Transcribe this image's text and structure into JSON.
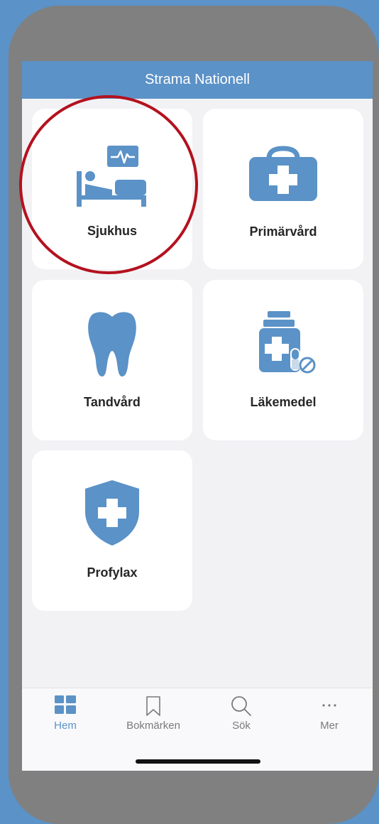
{
  "header": {
    "title": "Strama Nationell"
  },
  "tiles": [
    {
      "label": "Sjukhus",
      "icon": "hospital-bed-icon"
    },
    {
      "label": "Primärvård",
      "icon": "medical-bag-icon"
    },
    {
      "label": "Tandvård",
      "icon": "tooth-icon"
    },
    {
      "label": "Läkemedel",
      "icon": "medicine-bottle-icon"
    },
    {
      "label": "Profylax",
      "icon": "shield-cross-icon"
    }
  ],
  "tabbar": {
    "items": [
      {
        "label": "Hem",
        "icon": "grid-icon",
        "active": true
      },
      {
        "label": "Bokmärken",
        "icon": "bookmark-icon",
        "active": false
      },
      {
        "label": "Sök",
        "icon": "search-icon",
        "active": false
      },
      {
        "label": "Mer",
        "icon": "more-icon",
        "active": false
      }
    ]
  },
  "colors": {
    "accent": "#5b92c7",
    "highlight": "#b3121f",
    "background": "#f2f2f5"
  }
}
